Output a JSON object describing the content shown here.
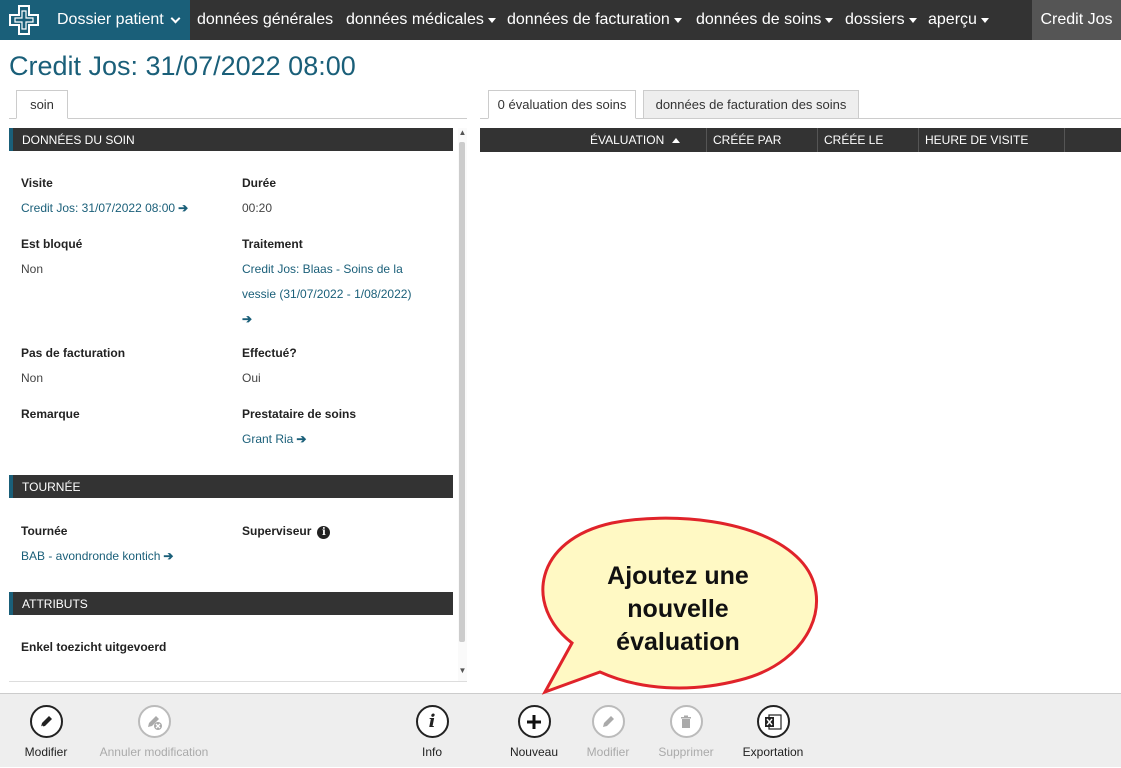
{
  "nav": {
    "dossier_label": "Dossier patient",
    "items": [
      "données générales",
      "données médicales",
      "données de facturation",
      "données de soins",
      "dossiers",
      "aperçu"
    ],
    "user": "Credit Jos"
  },
  "page_title": "Credit Jos: 31/07/2022 08:00",
  "left_tabs": {
    "soin": "soin"
  },
  "right_tabs": {
    "evaluation": "0 évaluation des soins",
    "facturation": "données de facturation des soins"
  },
  "sections": {
    "donnees_du_soin": "DONNÉES DU SOIN",
    "tournee": "TOURNÉE",
    "attributs": "ATTRIBUTS"
  },
  "fields": {
    "visite_label": "Visite",
    "visite_value": "Credit Jos: 31/07/2022 08:00",
    "duree_label": "Durée",
    "duree_value": "00:20",
    "est_bloque_label": "Est bloqué",
    "est_bloque_value": "Non",
    "traitement_label": "Traitement",
    "traitement_line1": "Credit Jos: Blaas - Soins de la",
    "traitement_line2": "vessie (31/07/2022 - 1/08/2022)",
    "pas_facturation_label": "Pas de facturation",
    "pas_facturation_value": "Non",
    "effectue_label": "Effectué?",
    "effectue_value": "Oui",
    "remarque_label": "Remarque",
    "prestataire_label": "Prestataire de soins",
    "prestataire_value": "Grant Ria",
    "tournee_label": "Tournée",
    "tournee_value": "BAB - avondronde kontich",
    "superviseur_label": "Superviseur",
    "attribut_label": "Enkel toezicht uitgevoerd"
  },
  "table": {
    "columns": [
      "ÉVALUATION",
      "CRÉÉE PAR",
      "CRÉÉE LE",
      "HEURE DE VISITE"
    ]
  },
  "callout": [
    "Ajoutez une",
    "nouvelle",
    "évaluation"
  ],
  "toolbar": {
    "modifier": "Modifier",
    "annuler": "Annuler modification",
    "info": "Info",
    "nouveau": "Nouveau",
    "modifier2": "Modifier",
    "supprimer": "Supprimer",
    "exportation": "Exportation"
  },
  "colors": {
    "brand": "#1a5f79",
    "nav_bg": "#333333",
    "callout_fill": "#fff9c4",
    "callout_border": "#e0232a"
  }
}
